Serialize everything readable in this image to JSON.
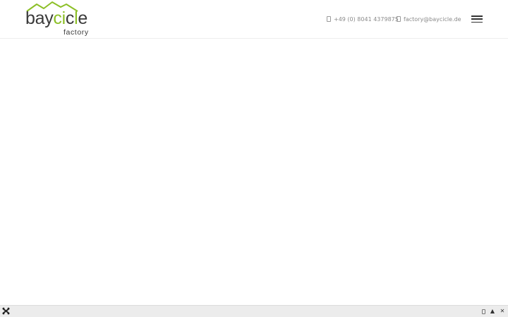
{
  "brand": {
    "name_prefix": "bay",
    "name_accent": "ci",
    "name_middle": "c",
    "name_accent2": "l",
    "name_suffix": "e",
    "tagline": "factory"
  },
  "contact": {
    "phone": "+49 (0) 8041 4379875",
    "email": "factory@baycicle.de"
  },
  "colors": {
    "accent": "#8cbf26",
    "text": "#3a3a3a",
    "toolbar": "#ececec"
  },
  "icons": {
    "phone": "phone-icon",
    "email": "envelope-icon",
    "menu": "hamburger-menu-icon",
    "toolbar": [
      "joomla-icon",
      "box-icon",
      "chevron-up-icon",
      "close-icon"
    ]
  }
}
